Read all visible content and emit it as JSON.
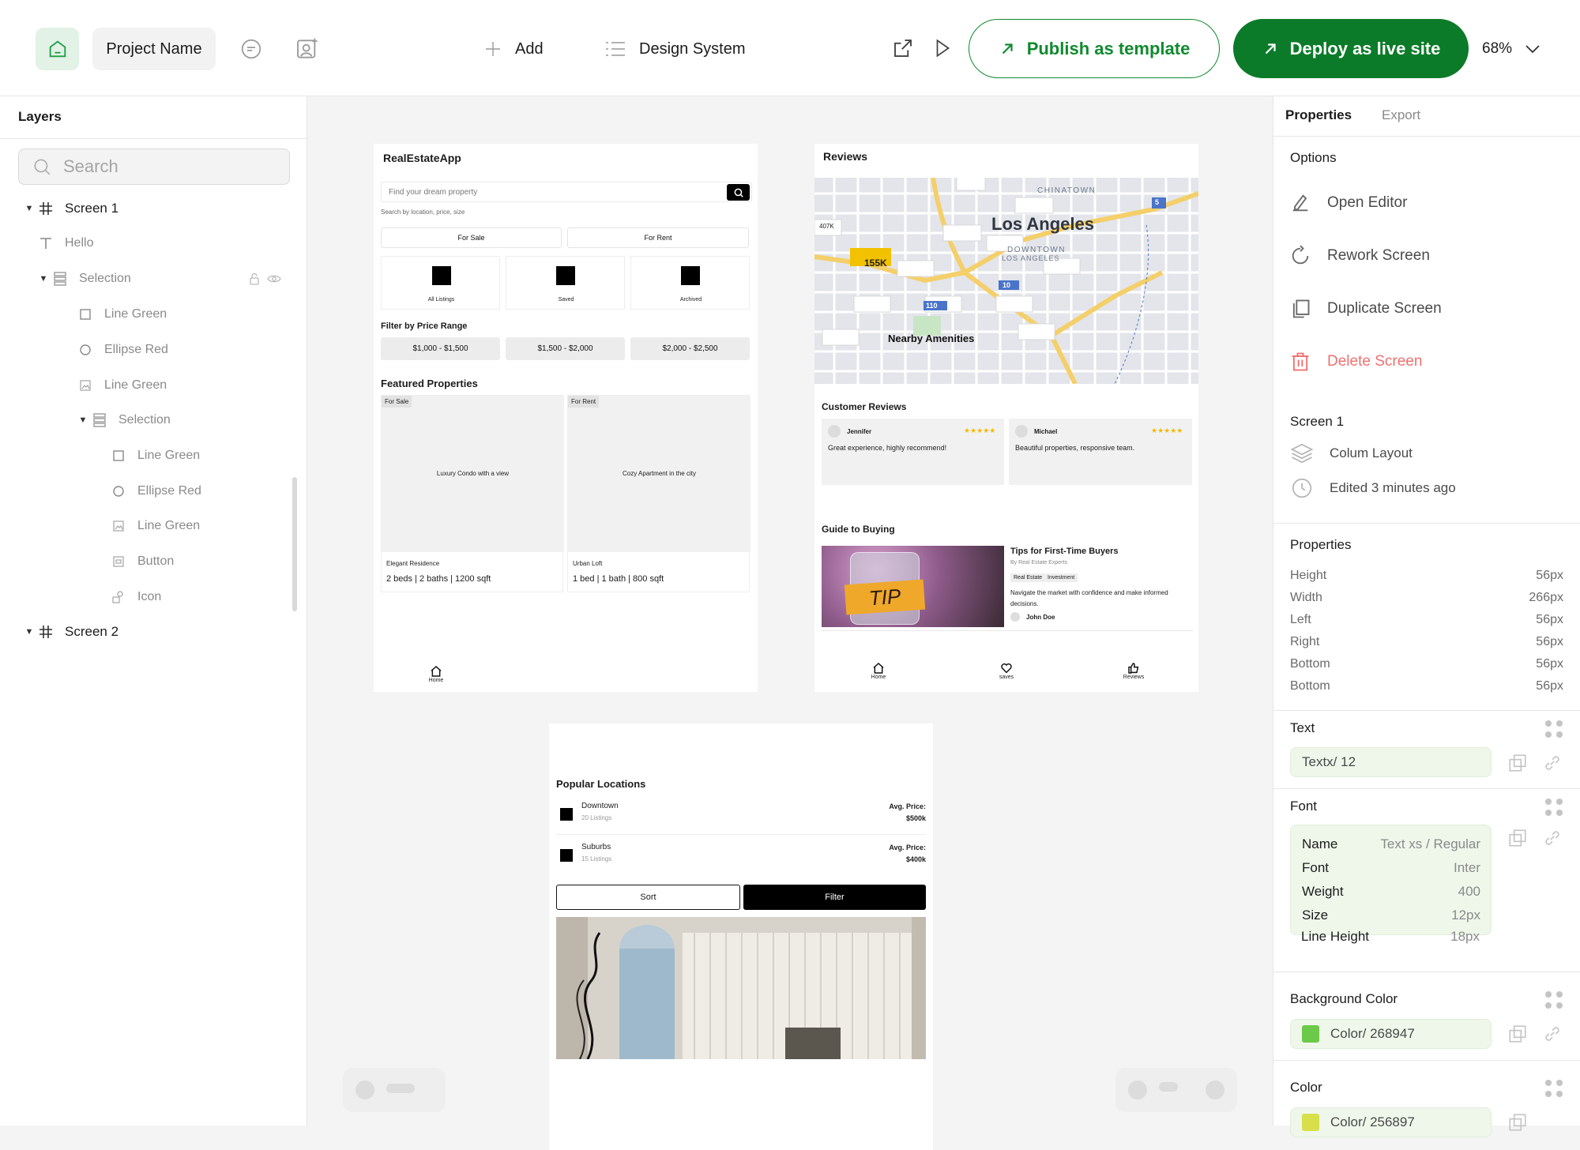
{
  "topbar": {
    "project_name": "Project Name",
    "add_label": "Add",
    "design_system_label": "Design System",
    "publish_label": "Publish as template",
    "deploy_label": "Deploy as live site",
    "zoom": "68%"
  },
  "layers": {
    "title": "Layers",
    "search_placeholder": "Search",
    "items": [
      {
        "label": "Screen 1"
      },
      {
        "label": "Hello"
      },
      {
        "label": "Selection"
      },
      {
        "label": "Line Green"
      },
      {
        "label": "Ellipse Red"
      },
      {
        "label": "Line Green"
      },
      {
        "label": "Selection"
      },
      {
        "label": "Line Green"
      },
      {
        "label": "Ellipse Red"
      },
      {
        "label": "Line Green"
      },
      {
        "label": "Button"
      },
      {
        "label": "Icon"
      },
      {
        "label": "Screen 2"
      }
    ]
  },
  "screen1": {
    "title": "RealEstateApp",
    "search_placeholder": "Find your dream property",
    "search_hint": "Search by location, price, size",
    "tabs": [
      "For Sale",
      "For Rent"
    ],
    "categories": [
      "All Listings",
      "Saved",
      "Archived"
    ],
    "price_heading": "Filter by Price Range",
    "price_ranges": [
      "$1,000 - $1,500",
      "$1,500 - $2,000",
      "$2,000 - $2,500"
    ],
    "featured_heading": "Featured Properties",
    "properties": [
      {
        "badge": "For Sale",
        "caption": "Luxury Condo with a view",
        "name": "Elegant Residence",
        "specs": "2 beds | 2 baths | 1200 sqft"
      },
      {
        "badge": "For Rent",
        "caption": "Cozy Apartment in the city",
        "name": "Urban Loft",
        "specs": "1 bed | 1 bath | 800 sqft"
      }
    ],
    "nav_home": "Home"
  },
  "screen2": {
    "title": "Reviews",
    "map": {
      "city": "Los Angeles",
      "district_top": "CHINATOWN",
      "district": "DOWNTOWN",
      "district_sub": "LOS ANGELES",
      "price_tag": "155K",
      "small_tag": "407K",
      "amenities": "Nearby Amenities",
      "shields": [
        "5",
        "110",
        "10"
      ]
    },
    "reviews_heading": "Customer Reviews",
    "reviews": [
      {
        "name": "Jennifer",
        "stars": "★★★★★",
        "text": "Great experience, highly recommend!"
      },
      {
        "name": "Michael",
        "stars": "★★★★★",
        "text": "Beautiful properties, responsive team."
      }
    ],
    "guide_heading": "Guide to Buying",
    "article": {
      "title": "Tips for First-Time Buyers",
      "byline": "By Real Estate Experts",
      "tags": [
        "Real Estate",
        "Investment"
      ],
      "summary": "Navigate the market with confidence and make informed decisions.",
      "author": "John Doe",
      "jar_text": "TIP"
    },
    "nav": [
      "Home",
      "saves",
      "Reviews"
    ]
  },
  "screen3": {
    "heading": "Popular Locations",
    "locations": [
      {
        "name": "Downtown",
        "count": "20 Listings",
        "price_label": "Avg. Price:",
        "price": "$500k"
      },
      {
        "name": "Suburbs",
        "count": "15 Listings",
        "price_label": "Avg. Price:",
        "price": "$400k"
      }
    ],
    "sort_label": "Sort",
    "filter_label": "Filter"
  },
  "properties_panel": {
    "tab_properties": "Properties",
    "tab_export": "Export",
    "options_heading": "Options",
    "options": [
      {
        "label": "Open Editor",
        "icon": "pencil-icon"
      },
      {
        "label": "Rework Screen",
        "icon": "refresh-icon"
      },
      {
        "label": "Duplicate Screen",
        "icon": "duplicate-icon"
      },
      {
        "label": "Delete Screen",
        "icon": "trash-icon"
      }
    ],
    "screen_name": "Screen 1",
    "layout": "Colum Layout",
    "edited": "Edited 3 minutes ago",
    "props_heading": "Properties",
    "props": [
      {
        "label": "Height",
        "value": "56px"
      },
      {
        "label": "Width",
        "value": "266px"
      },
      {
        "label": "Left",
        "value": "56px"
      },
      {
        "label": "Right",
        "value": "56px"
      },
      {
        "label": "Bottom",
        "value": "56px"
      },
      {
        "label": "Bottom",
        "value": "56px"
      }
    ],
    "text_heading": "Text",
    "text_value": "Textx/  12",
    "font_heading": "Font",
    "font_rows": [
      {
        "label": "Name",
        "value": "Text xs / Regular"
      },
      {
        "label": "Font",
        "value": "Inter"
      },
      {
        "label": "Weight",
        "value": "400"
      },
      {
        "label": "Size",
        "value": "12px"
      },
      {
        "label": "Line Height",
        "value": "18px"
      }
    ],
    "bg_heading": "Background Color",
    "bg_value": "Color/ 268947",
    "bg_swatch": "#6cc94a",
    "color_heading": "Color",
    "color_value": "Color/ 256897",
    "color_swatch": "#d7e04a"
  },
  "colors": {
    "brand_green": "#0c7b29",
    "delete_red": "#f07070",
    "star_yellow": "#f5b800"
  }
}
